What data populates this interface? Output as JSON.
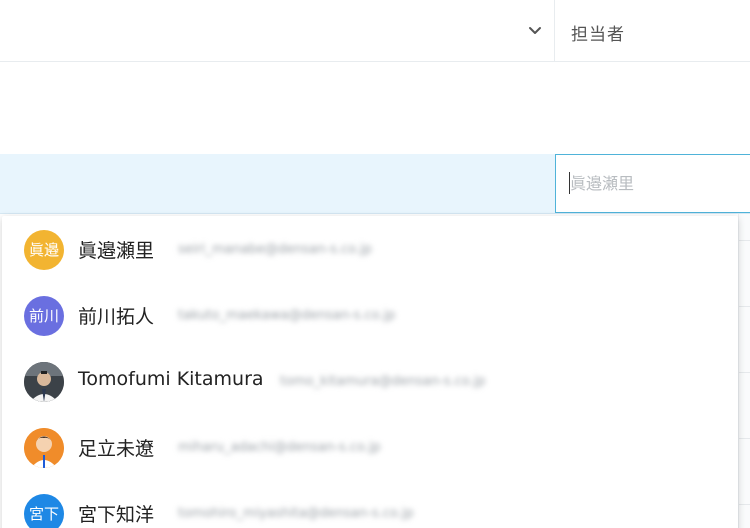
{
  "header": {
    "assignee_label": "担当者"
  },
  "assignee_input": {
    "value": "",
    "placeholder": "眞邉瀬里"
  },
  "options": [
    {
      "avatar_text": "眞邉",
      "avatar_color": "#f2b431",
      "name": "眞邉瀬里",
      "email": "seiri_manabe@densan-s.co.jp"
    },
    {
      "avatar_text": "前川",
      "avatar_color": "#6a6fe0",
      "name": "前川拓人",
      "email": "takuto_maekawa@densan-s.co.jp"
    },
    {
      "avatar_text": "",
      "avatar_color": "#4a4f55",
      "name": "Tomofumi Kitamura",
      "email": "tomo_kitamura@densan-s.co.jp"
    },
    {
      "avatar_text": "",
      "avatar_color": "#f08c2a",
      "name": "足立未遼",
      "email": "miharu_adachi@densan-s.co.jp"
    },
    {
      "avatar_text": "宮下",
      "avatar_color": "#1e88e5",
      "name": "宮下知洋",
      "email": "tomohiro_miyashita@densan-s.co.jp"
    }
  ],
  "colors": {
    "selected_row": "#e8f5fd",
    "input_border": "#4fb3d9"
  }
}
